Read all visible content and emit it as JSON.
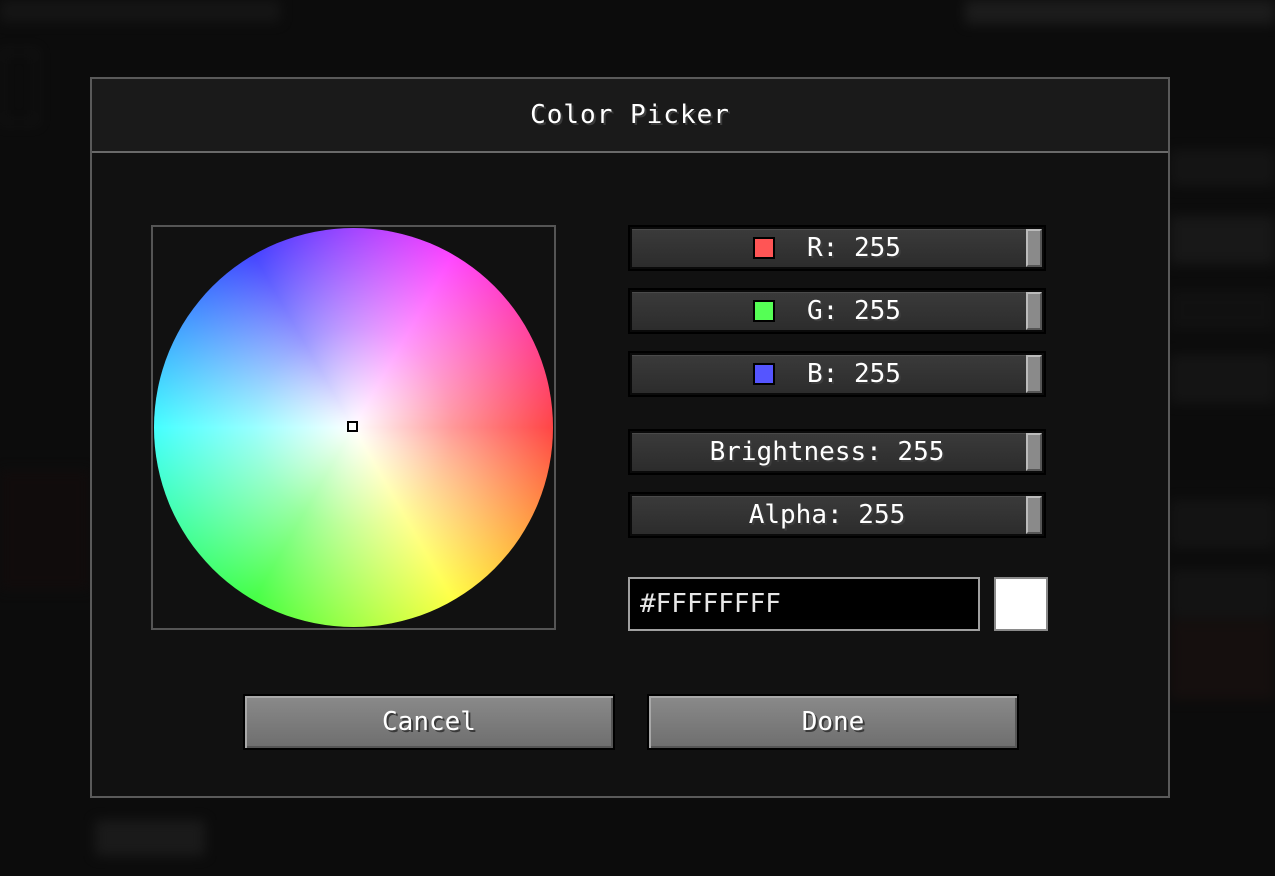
{
  "dialog": {
    "title": "Color Picker"
  },
  "sliders": {
    "red": {
      "label": "R: 255",
      "swatch_color": "#ff5555"
    },
    "green": {
      "label": "G: 255",
      "swatch_color": "#55ff55"
    },
    "blue": {
      "label": "B: 255",
      "swatch_color": "#5555ff"
    },
    "brightness": {
      "label": "Brightness: 255"
    },
    "alpha": {
      "label": "Alpha: 255"
    }
  },
  "hex": {
    "value": "#FFFFFFFF"
  },
  "preview": {
    "color": "#ffffff"
  },
  "buttons": {
    "cancel": "Cancel",
    "done": "Done"
  }
}
